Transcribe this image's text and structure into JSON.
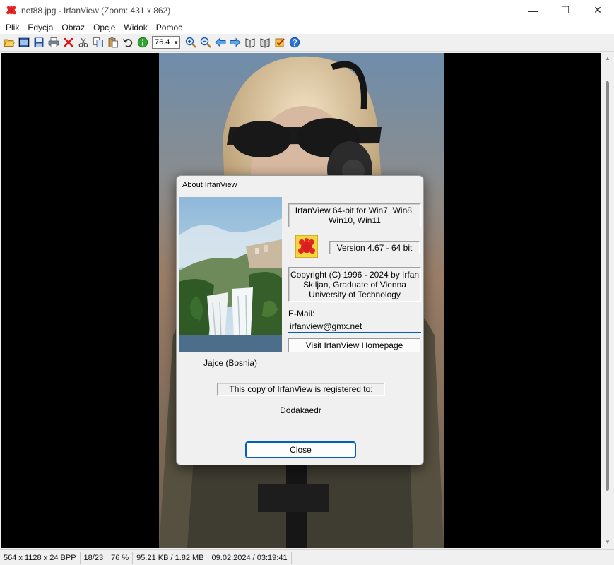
{
  "window": {
    "title": "net88.jpg - IrfanView (Zoom: 431 x 862)",
    "controls": {
      "minimize": "—",
      "maximize": "☐",
      "close": "✕"
    }
  },
  "menu": [
    "Plik",
    "Edycja",
    "Obraz",
    "Opcje",
    "Widok",
    "Pomoc"
  ],
  "toolbar": {
    "icons_left": [
      "open-folder-icon",
      "slideshow-icon",
      "save-icon",
      "print-icon",
      "delete-icon",
      "cut-icon",
      "copy-icon",
      "paste-icon",
      "undo-icon",
      "info-icon"
    ],
    "zoom_value": "76.4",
    "icons_right": [
      "zoom-in-icon",
      "zoom-out-icon",
      "previous-icon",
      "next-icon",
      "book-icon",
      "paint-icon",
      "checkbox-icon",
      "help-icon"
    ]
  },
  "status": {
    "dimensions": "564 x 1128 x 24 BPP",
    "index": "18/23",
    "zoom": "76 %",
    "size": "95.21 KB / 1.82 MB",
    "date": "09.02.2024 / 03:19:41"
  },
  "about": {
    "title": "About  IrfanView",
    "product": "IrfanView 64-bit for Win7, Win8, Win10, Win11",
    "version": "Version 4.67 - 64 bit",
    "copyright": "Copyright (C) 1996 - 2024 by Irfan Skiljan, Graduate of Vienna University of Technology",
    "email_label": "E-Mail:",
    "email_value": "irfanview@gmx.net",
    "homepage_button": "Visit IrfanView Homepage",
    "picture_caption": "Jajce (Bosnia)",
    "registered_text": "This copy of IrfanView is registered to:",
    "registered_name": "Dodakaedr",
    "close_button": "Close"
  }
}
